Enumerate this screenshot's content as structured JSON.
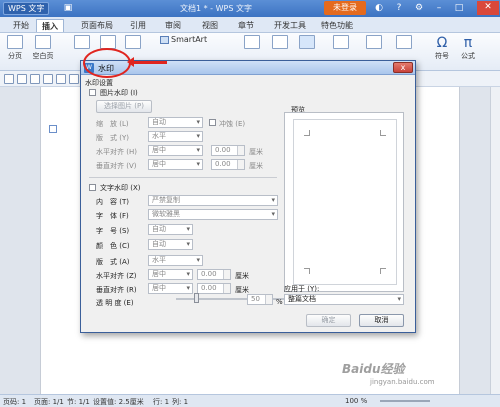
{
  "app": {
    "logo": "WPS 文字",
    "doc_title": "文档1 * - WPS 文字",
    "login": "未登录"
  },
  "tabs": [
    "开始",
    "插入",
    "页面布局",
    "引用",
    "审阅",
    "视图",
    "章节",
    "开发工具",
    "特色功能"
  ],
  "ribbon": {
    "items": [
      "分页",
      "空白页",
      "SmartArt",
      "符号",
      "公式"
    ],
    "symbol_glyph": "Ω",
    "formula_glyph": "π"
  },
  "dialog": {
    "title": "水印",
    "close_glyph": "x",
    "settings_group": "水印设置",
    "image_wm": {
      "checkbox_label": "图片水印 (I)",
      "select_image_button": "选择图片 (P)",
      "scale_label": "缩　放 (L)",
      "scale_value": "自动",
      "washout_label": "冲蚀 (E)",
      "layout_label": "版　式 (Y)",
      "layout_value": "水平",
      "halign_label": "水平对齐 (H)",
      "halign_value": "居中",
      "halign_offset": "0.00",
      "valign_label": "垂直对齐 (V)",
      "valign_value": "居中",
      "valign_offset": "0.00",
      "unit": "厘米"
    },
    "text_wm": {
      "checkbox_label": "文字水印 (X)",
      "content_label": "内　容 (T)",
      "content_value": "严禁复制",
      "font_label": "字　体 (F)",
      "font_value": "微软雅黑",
      "size_label": "字　号 (S)",
      "size_value": "自动",
      "color_label": "颜　色 (C)",
      "color_value": "自动",
      "layout_label": "版　式 (A)",
      "layout_value": "水平",
      "halign_label": "水平对齐 (Z)",
      "halign_value": "居中",
      "halign_offset": "0.00",
      "valign_label": "垂直对齐 (R)",
      "valign_value": "居中",
      "valign_offset": "0.00",
      "unit": "厘米",
      "transparency_label": "透 明 度 (E)",
      "transparency_value": "50",
      "transparency_unit": "%"
    },
    "preview_label": "预览",
    "apply_to_label": "应用于 (Y):",
    "apply_to_value": "整篇文档",
    "ok_button": "确定",
    "cancel_button": "取消"
  },
  "status": {
    "page": "页码: 1",
    "pages": "页面: 1/1",
    "section": "节: 1/1",
    "setting": "设置值: 2.5厘米",
    "row": "行: 1",
    "col": "列: 1",
    "zoom": "100 %"
  },
  "watermark": {
    "line1": "Baidu经验",
    "line2": "jingyan.baidu.com"
  },
  "colors": {
    "title_bar": "#3c73c2",
    "login": "#e46a1e",
    "highlight": "#e0251f"
  }
}
